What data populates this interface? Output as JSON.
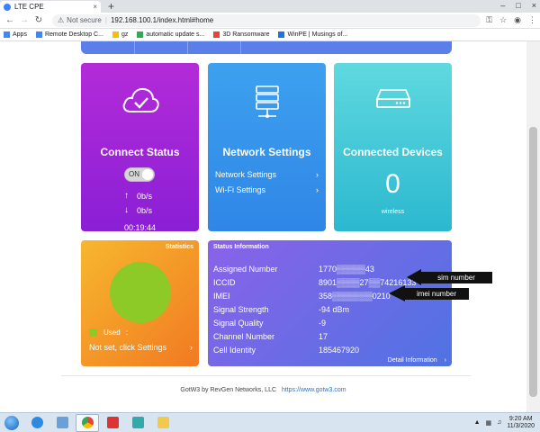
{
  "browser": {
    "tab_title": "LTE CPE",
    "tab_close": "×",
    "new_tab": "+",
    "win_min": "–",
    "win_max": "□",
    "win_close": "×",
    "security_label": "Not secure",
    "url": "192.168.100.1/index.html#home",
    "bookmarks": [
      {
        "label": "Apps",
        "icon": "apps-grid-icon",
        "color": "#4285f4"
      },
      {
        "label": "Remote Desktop C...",
        "icon": "remote-desktop-icon",
        "color": "#4285f4"
      },
      {
        "label": "gz",
        "icon": "folder-icon",
        "color": "#fbbc05"
      },
      {
        "label": "automatic update s...",
        "icon": "page-icon",
        "color": "#34a853"
      },
      {
        "label": "3D Ransomware",
        "icon": "shield-icon",
        "color": "#ea4335"
      },
      {
        "label": "WinPE | Musings of...",
        "icon": "blog-icon",
        "color": "#1a73e8"
      }
    ]
  },
  "cards": {
    "connect": {
      "title": "Connect Status",
      "toggle": "ON",
      "upload": "0b/s",
      "download": "0b/s",
      "elapsed": "00:19:44",
      "icon": "cloud-check-icon"
    },
    "network": {
      "title": "Network Settings",
      "links": [
        "Network Settings",
        "Wi-Fi Settings"
      ],
      "icon": "server-icon"
    },
    "devices": {
      "title": "Connected Devices",
      "count": "0",
      "label": "wireless",
      "icon": "router-icon"
    },
    "stats": {
      "title": "Statistics",
      "legend_label": "Used",
      "legend_value": ":",
      "link": "Not set, click Settings",
      "used_color": "#8dc927"
    },
    "status": {
      "title": "Status Information",
      "rows": [
        {
          "key": "Assigned Number",
          "value": "1770▒▒▒▒▒43"
        },
        {
          "key": "ICCID",
          "value": "8901▒▒▒▒27▒▒74216133"
        },
        {
          "key": "IMEI",
          "value": "358▒▒▒▒▒▒▒0210"
        },
        {
          "key": "Signal Strength",
          "value": "-94 dBm"
        },
        {
          "key": "Signal Quality",
          "value": "-9"
        },
        {
          "key": "Channel Number",
          "value": "17"
        },
        {
          "key": "Cell Identity",
          "value": "185467920"
        }
      ],
      "detail_link": "Detail Information"
    }
  },
  "annotations": {
    "sim": "sim number",
    "imei": "imei number"
  },
  "footer": {
    "text": "GotW3 by RevGen Networks, LLC",
    "link": "https://www.gotw3.com"
  },
  "taskbar": {
    "time": "9:20 AM",
    "date": "11/3/2020"
  }
}
